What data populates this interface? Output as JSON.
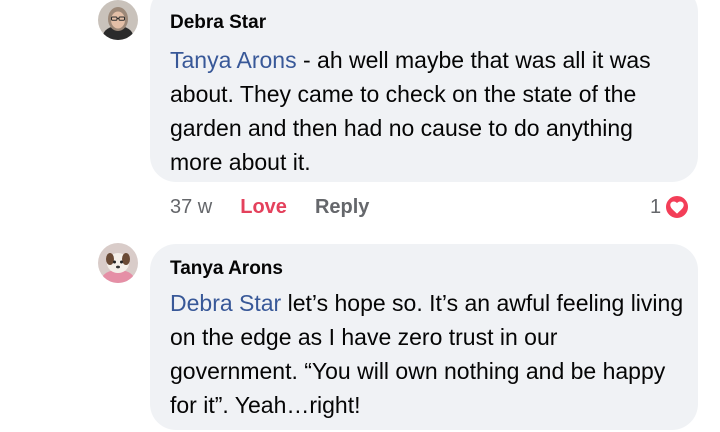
{
  "comments": [
    {
      "author": "Debra Star",
      "mention": "Tanya Arons",
      "text": "  - ah well maybe that was all it was about. They came to check on the state of the garden and then had no cause to do anything more about it.",
      "timestamp": "37 w",
      "love_label": "Love",
      "reply_label": "Reply",
      "reaction_count": "1",
      "reaction_icon": "heart-icon",
      "avatar": "avatar-photo"
    },
    {
      "author": "Tanya Arons",
      "mention": "Debra Star",
      "text": " let’s hope so. It’s an awful feeling living on the edge as I have zero trust in our government. “You will own nothing and be happy for it”. Yeah…right!",
      "avatar": "avatar-photo"
    }
  ],
  "colors": {
    "bubble": "#f0f2f5",
    "mention": "#385898",
    "love": "#e4415c",
    "meta": "#65676b",
    "heart": "#f33e58"
  }
}
